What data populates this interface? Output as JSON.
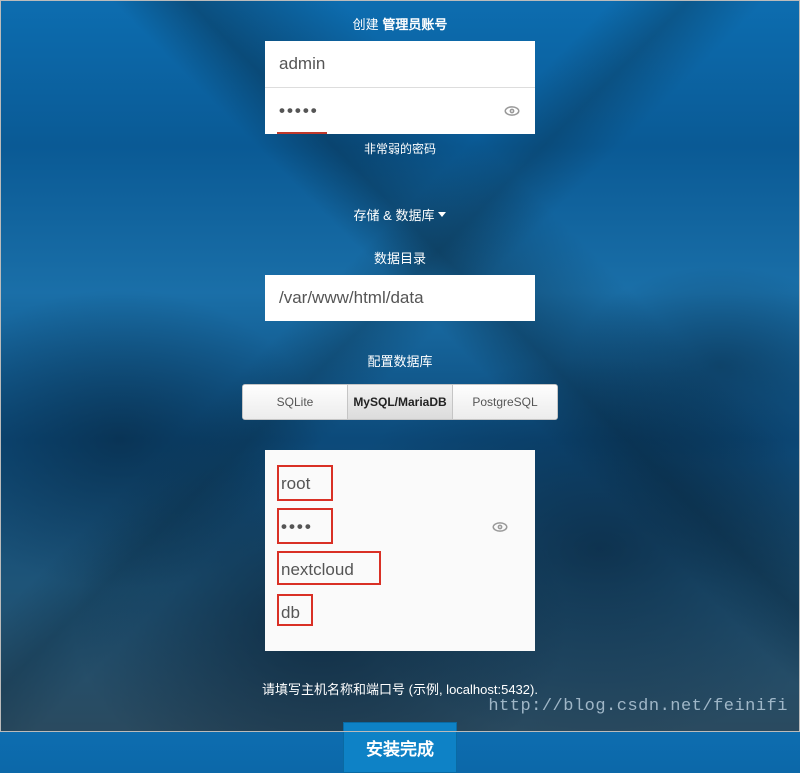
{
  "admin": {
    "title_prefix": "创建",
    "title_bold": "管理员账号",
    "username": "admin",
    "password_masked": "•••••",
    "strength_hint": "非常弱的密码"
  },
  "storage": {
    "toggle_label": "存储 & 数据库",
    "data_dir_label": "数据目录",
    "data_dir_value": "/var/www/html/data"
  },
  "db": {
    "config_label": "配置数据库",
    "tabs": {
      "sqlite": "SQLite",
      "mysql": "MySQL/MariaDB",
      "postgres": "PostgreSQL"
    },
    "user": "root",
    "password_masked": "••••",
    "name": "nextcloud",
    "host": "db",
    "host_hint": "请填写主机名称和端口号 (示例, localhost:5432)."
  },
  "install_button": "安装完成",
  "watermark": "http://blog.csdn.net/feinifi"
}
